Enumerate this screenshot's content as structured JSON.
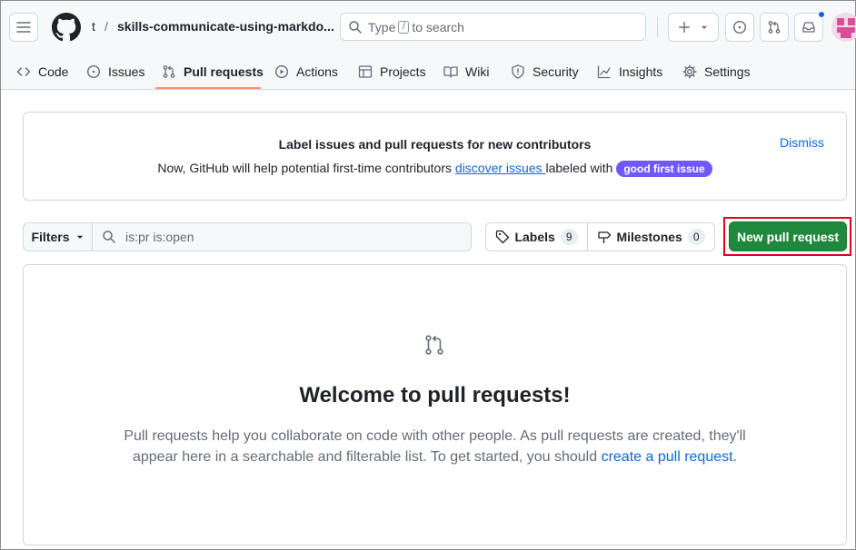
{
  "header": {
    "owner": "t",
    "separator": "/",
    "repo": "skills-communicate-using-markdo...",
    "search_pre": "Type",
    "search_key": "/",
    "search_post": "to search"
  },
  "tabs": [
    {
      "label": "Code",
      "icon": "code-icon"
    },
    {
      "label": "Issues",
      "icon": "issue-opened-icon"
    },
    {
      "label": "Pull requests",
      "icon": "git-pull-request-icon",
      "active": true
    },
    {
      "label": "Actions",
      "icon": "play-icon"
    },
    {
      "label": "Projects",
      "icon": "table-icon"
    },
    {
      "label": "Wiki",
      "icon": "book-icon"
    },
    {
      "label": "Security",
      "icon": "shield-icon"
    },
    {
      "label": "Insights",
      "icon": "graph-icon"
    },
    {
      "label": "Settings",
      "icon": "gear-icon"
    }
  ],
  "banner": {
    "title": "Label issues and pull requests for new contributors",
    "text_pre": "Now, GitHub will help potential first-time contributors ",
    "link": "discover issues ",
    "text_post": "labeled with ",
    "pill": "good first issue",
    "dismiss": "Dismiss",
    "pill_color": "#7057ff"
  },
  "toolbar": {
    "filters": "Filters",
    "filter_value": "is:pr is:open",
    "labels": "Labels",
    "labels_count": "9",
    "milestones": "Milestones",
    "milestones_count": "0",
    "new_pr": "New pull request",
    "new_pr_color": "#1f883d"
  },
  "blank": {
    "title": "Welcome to pull requests!",
    "body_pre": "Pull requests help you collaborate on code with other people. As pull requests are created, they'll appear here in a searchable and filterable list. To get started, you should ",
    "link": "create a pull request",
    "body_post": "."
  }
}
